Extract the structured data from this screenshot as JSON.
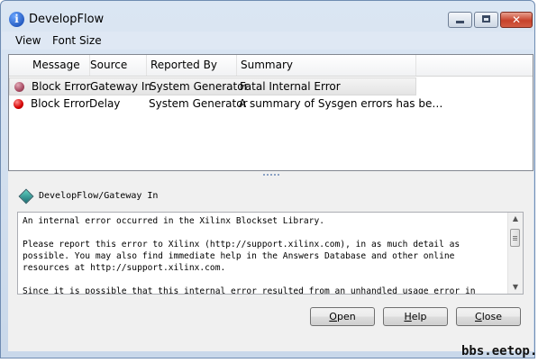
{
  "window": {
    "title": "DevelopFlow",
    "close_glyph": "✕",
    "info_glyph": "i"
  },
  "menu": [
    "View",
    "Font Size"
  ],
  "table": {
    "columns": [
      "Message",
      "Source",
      "Reported By",
      "Summary"
    ],
    "rows": [
      {
        "message": "Block Error",
        "source": "Gateway In",
        "reported_by": "System Generator",
        "summary": "Fatal Internal Error",
        "selected": true,
        "icon": "error-icon-dim"
      },
      {
        "message": "Block Error",
        "source": "Delay",
        "reported_by": "System Generator",
        "summary": "A summary of Sysgen errors has be…",
        "selected": false,
        "icon": "error-icon"
      }
    ]
  },
  "detail": {
    "path": "DevelopFlow/Gateway In",
    "message": "An internal error occurred in the Xilinx Blockset Library.\n\nPlease report this error to Xilinx (http://support.xilinx.com), in as much detail as possible. You may also find immediate help in the Answers Database and other online resources at http://support.xilinx.com.\n\nSince it is possible that this internal error resulted from an unhandled usage error in"
  },
  "buttons": {
    "open": {
      "mnemonic": "O",
      "rest": "pen"
    },
    "help": {
      "mnemonic": "H",
      "rest": "elp"
    },
    "close": {
      "mnemonic": "C",
      "rest": "lose"
    }
  },
  "watermark": "bbs.eetop.cn"
}
